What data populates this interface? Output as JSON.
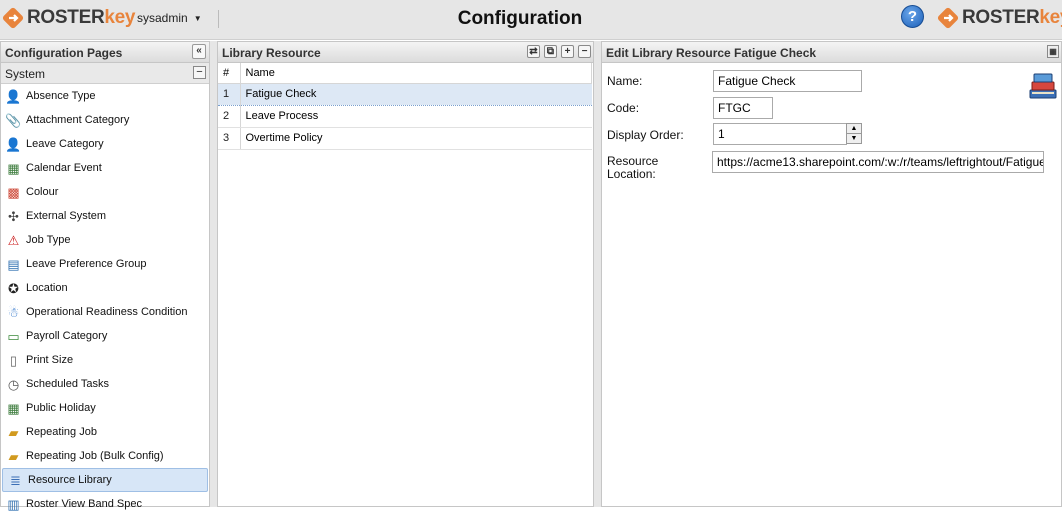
{
  "header": {
    "brand_left": "ROSTERkey",
    "brand_right": "ROSTERkey",
    "user": "sysadmin",
    "title": "Configuration",
    "help": "?"
  },
  "sidebar": {
    "title": "Configuration Pages",
    "collapse": "«",
    "group": "System",
    "group_toggle": "−",
    "items": [
      {
        "label": "Absence Type",
        "icon": "person-icon"
      },
      {
        "label": "Attachment Category",
        "icon": "paperclip-icon"
      },
      {
        "label": "Leave Category",
        "icon": "person-icon"
      },
      {
        "label": "Calendar Event",
        "icon": "calendar-icon"
      },
      {
        "label": "Colour",
        "icon": "palette-icon"
      },
      {
        "label": "External System",
        "icon": "network-icon"
      },
      {
        "label": "Job Type",
        "icon": "warning-icon"
      },
      {
        "label": "Leave Preference Group",
        "icon": "chart-icon"
      },
      {
        "label": "Location",
        "icon": "compass-icon"
      },
      {
        "label": "Operational Readiness Condition",
        "icon": "figure-icon"
      },
      {
        "label": "Payroll Category",
        "icon": "money-icon"
      },
      {
        "label": "Print Size",
        "icon": "page-icon"
      },
      {
        "label": "Scheduled Tasks",
        "icon": "clock-page-icon"
      },
      {
        "label": "Public Holiday",
        "icon": "calendar-icon"
      },
      {
        "label": "Repeating Job",
        "icon": "folders-icon"
      },
      {
        "label": "Repeating Job (Bulk Config)",
        "icon": "folders-icon"
      },
      {
        "label": "Resource Library",
        "icon": "books-icon"
      },
      {
        "label": "Roster View Band Spec",
        "icon": "grid-icon"
      }
    ],
    "selected_index": 16
  },
  "library": {
    "title": "Library Resource",
    "col_num": "#",
    "col_name": "Name",
    "rows": [
      {
        "num": "1",
        "name": "Fatigue Check"
      },
      {
        "num": "2",
        "name": "Leave Process"
      },
      {
        "num": "3",
        "name": "Overtime Policy"
      }
    ],
    "selected_row": 0
  },
  "edit": {
    "title": "Edit Library Resource Fatigue Check",
    "name_label": "Name:",
    "name_value": "Fatigue Check",
    "code_label": "Code:",
    "code_value": "FTGC",
    "order_label": "Display Order:",
    "order_value": "1",
    "location_label_1": "Resource",
    "location_label_2": "Location:",
    "location_value": "https://acme13.sharepoint.com/:w:/r/teams/leftrightout/Fatigue"
  },
  "colors": {
    "accent_orange": "#e8843c",
    "selection": "#d7e6f7",
    "help_blue": "#1b5fb8"
  }
}
